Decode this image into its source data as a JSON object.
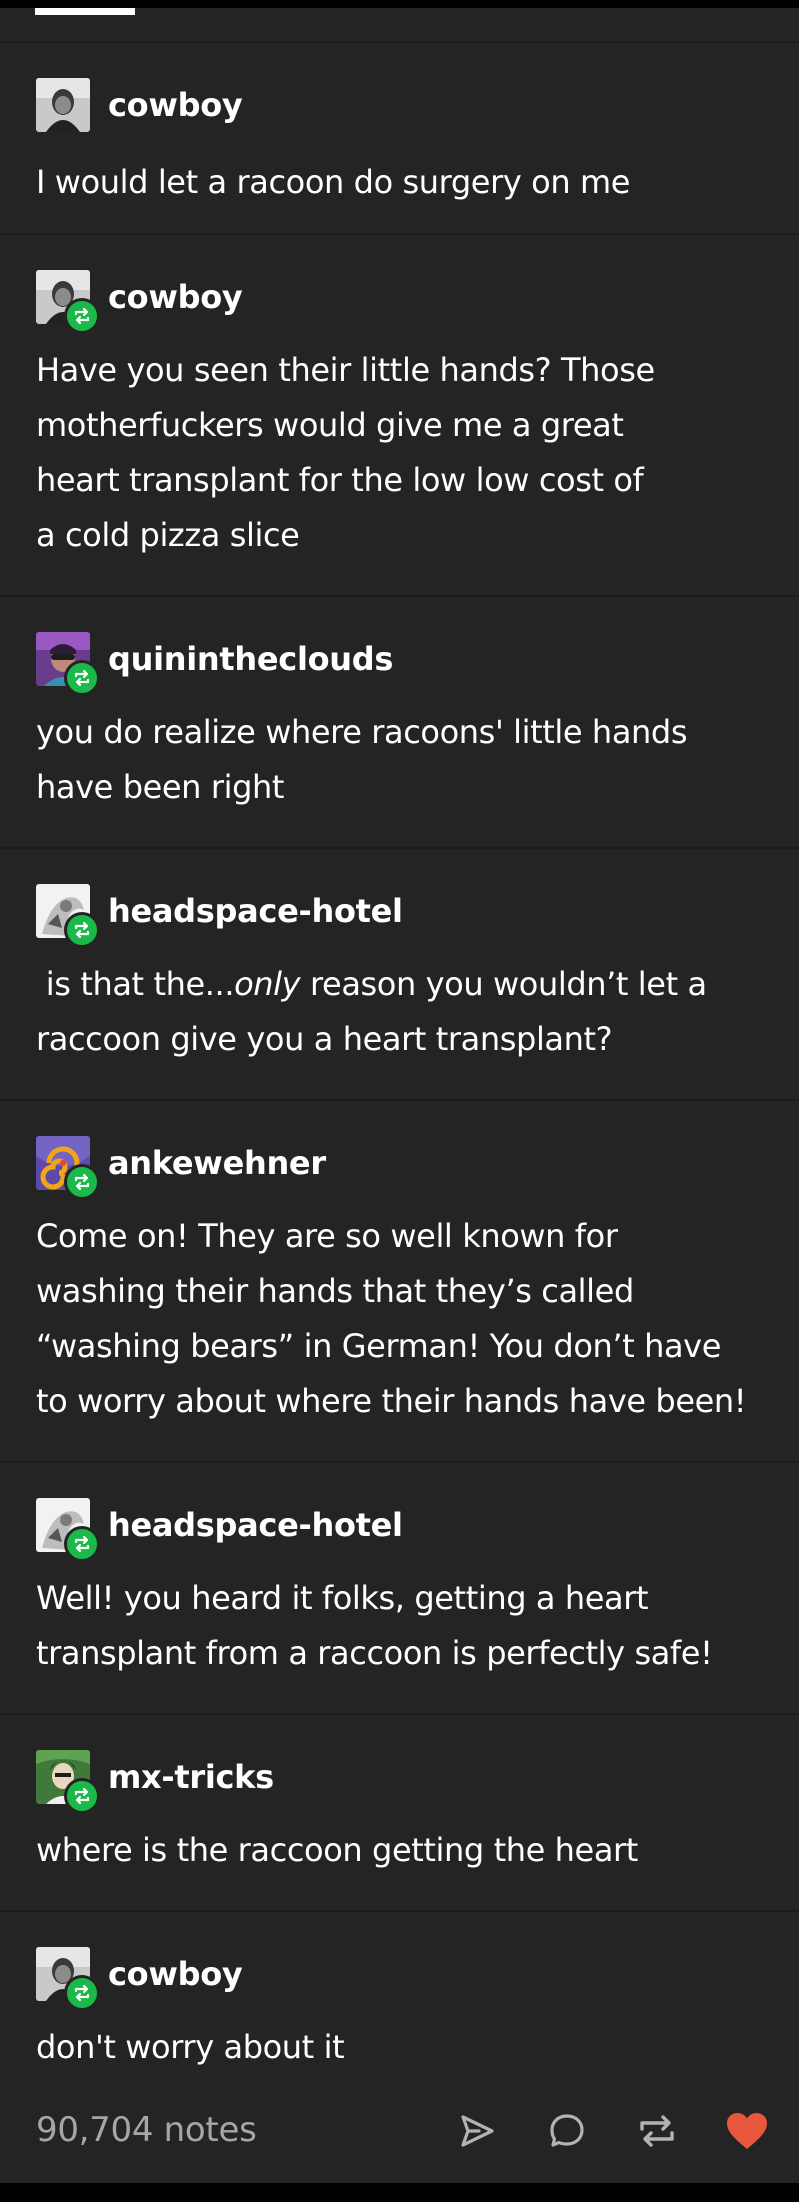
{
  "colors": {
    "background": "#242424",
    "separator": "#1b1b1b",
    "text": "#ffffff",
    "notes_text": "#a6a6a6",
    "reblog_badge": "#1ab94a",
    "like_heart": "#e8573b",
    "action_icon": "#b3b3b3"
  },
  "thread": [
    {
      "username": "cowboy",
      "reblog": false,
      "text": "I would let a racoon do surgery on me"
    },
    {
      "username": "cowboy",
      "reblog": true,
      "text": "Have you seen their little hands? Those\nmotherfuckers would give me a great\nheart transplant for the low low cost of\na cold pizza slice"
    },
    {
      "username": "quinintheclouds",
      "reblog": true,
      "text": "you do realize where racoons' little hands\nhave been right"
    },
    {
      "username": "headspace-hotel",
      "reblog": true,
      "text_before": " is that the...",
      "text_italic": "only",
      "text_after": " reason you wouldn’t let a\nraccoon give you a heart transplant?"
    },
    {
      "username": "ankewehner",
      "reblog": true,
      "text": "Come on! They are so well known for\nwashing their hands that they’s called\n“washing bears” in German! You don’t have\nto worry about where their hands have been!"
    },
    {
      "username": "headspace-hotel",
      "reblog": true,
      "text": "Well! you heard it folks, getting a heart\ntransplant from a raccoon is perfectly safe!"
    },
    {
      "username": "mx-tricks",
      "reblog": true,
      "text": "where is the raccoon getting the heart"
    },
    {
      "username": "cowboy",
      "reblog": true,
      "text": "don't worry about it"
    }
  ],
  "footer": {
    "notes": "90,704 notes",
    "actions": [
      "share-icon",
      "reply-icon",
      "reblog-icon",
      "like-icon"
    ]
  }
}
